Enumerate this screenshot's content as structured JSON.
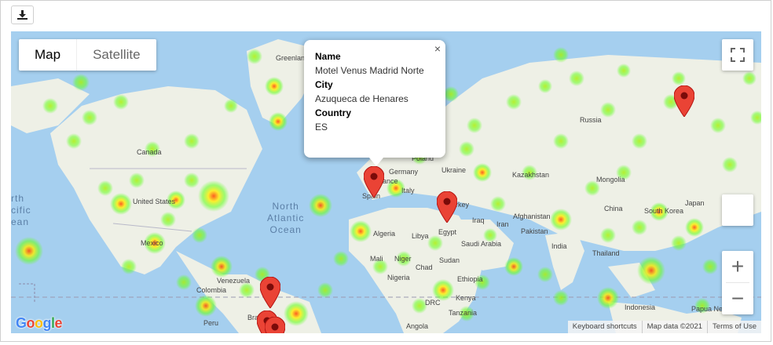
{
  "toolbar": {
    "download_icon": "download-icon"
  },
  "map": {
    "type_control": {
      "map_label": "Map",
      "satellite_label": "Satellite",
      "selected": "Map"
    },
    "zoom_in_label": "+",
    "zoom_out_label": "−",
    "fullscreen_icon": "fullscreen-icon",
    "info_window": {
      "name_label": "Name",
      "name_value": "Motel Venus Madrid Norte",
      "city_label": "City",
      "city_value": "Azuqueca de Henares",
      "country_label": "Country",
      "country_value": "ES",
      "close_label": "×"
    },
    "labels": {
      "greenland": "Greenland",
      "canada": "Canada",
      "united_states": "United States",
      "mexico": "Mexico",
      "venezuela": "Venezuela",
      "colombia": "Colombia",
      "peru": "Peru",
      "brazil": "Bra",
      "north_atlantic": "North\nAtlantic\nOcean",
      "france": "rance",
      "spain": "Spain",
      "germany": "Germany",
      "poland": "Poland",
      "ukraine": "Ukraine",
      "italy": "Italy",
      "turkey": "rkey",
      "iraq": "Iraq",
      "iran": "Iran",
      "egypt": "Egypt",
      "libya": "Libya",
      "algeria": "Algeria",
      "mali": "Mali",
      "niger": "Niger",
      "chad": "Chad",
      "sudan": "Sudan",
      "nigeria": "Nigeria",
      "ethiopia": "Ethiopia",
      "drc": "DRC",
      "kenya": "Kenya",
      "tanzania": "Tanzania",
      "angola": "Angola",
      "saudi_arabia": "Saudi Arabia",
      "afghanistan": "Afghanistan",
      "pakistan": "Pakistan",
      "india": "India",
      "kazakhstan": "Kazakhstan",
      "mongolia": "Mongolia",
      "china": "China",
      "south_korea": "South Korea",
      "japan": "Japan",
      "thailand": "Thailand",
      "indonesia": "Indonesia",
      "papua": "Papua Ne",
      "russia": "Russia",
      "north_pacific": "rth\ncific\nean"
    },
    "attribution": {
      "shortcuts": "Keyboard shortcuts",
      "data": "Map data ©2021",
      "terms": "Terms of Use"
    },
    "logo": "Google",
    "colors": {
      "water": "#a5cfef",
      "land": "#eef0e6",
      "marker": "#ea4335"
    }
  }
}
